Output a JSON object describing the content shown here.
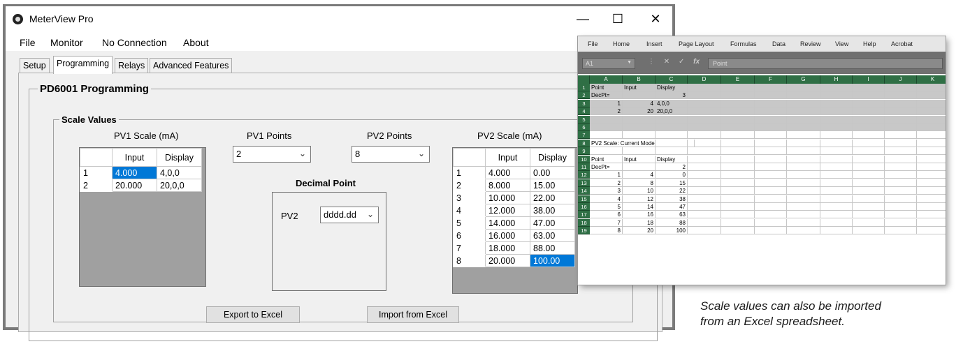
{
  "window": {
    "title": "MeterView Pro",
    "controls": {
      "minimize": "—",
      "maximize": "☐",
      "close": "✕"
    }
  },
  "menu": [
    "File",
    "Monitor",
    "No Connection",
    "About"
  ],
  "tabs": [
    "Setup",
    "Programming",
    "Relays",
    "Advanced Features"
  ],
  "active_tab": "Programming",
  "programming": {
    "group_title": "PD6001 Programming",
    "scale_group_title": "Scale Values",
    "pv1_scale": {
      "label": "PV1 Scale (mA)",
      "headers": [
        "Input",
        "Display"
      ],
      "rows": [
        {
          "n": "1",
          "input": "4.000",
          "display": "4,0,0"
        },
        {
          "n": "2",
          "input": "20.000",
          "display": "20,0,0"
        }
      ]
    },
    "pv1_points": {
      "label": "PV1 Points",
      "value": "2"
    },
    "pv2_points": {
      "label": "PV2 Points",
      "value": "8"
    },
    "decimal_point": {
      "title": "Decimal Point",
      "pv_label": "PV2",
      "value": "dddd.dd"
    },
    "pv2_scale": {
      "label": "PV2 Scale (mA)",
      "headers": [
        "Input",
        "Display"
      ],
      "rows": [
        {
          "n": "1",
          "input": "4.000",
          "display": "0.00"
        },
        {
          "n": "2",
          "input": "8.000",
          "display": "15.00"
        },
        {
          "n": "3",
          "input": "10.000",
          "display": "22.00"
        },
        {
          "n": "4",
          "input": "12.000",
          "display": "38.00"
        },
        {
          "n": "5",
          "input": "14.000",
          "display": "47.00"
        },
        {
          "n": "6",
          "input": "16.000",
          "display": "63.00"
        },
        {
          "n": "7",
          "input": "18.000",
          "display": "88.00"
        },
        {
          "n": "8",
          "input": "20.000",
          "display": "100.00"
        }
      ]
    },
    "export_button": "Export to Excel",
    "import_button": "Import from Excel"
  },
  "excel": {
    "ribbon_tabs": [
      "File",
      "Home",
      "Insert",
      "Page Layout",
      "Formulas",
      "Data",
      "Review",
      "View",
      "Help",
      "Acrobat"
    ],
    "name_box": "A1",
    "formula_value": "Point",
    "fx": "fx",
    "columns": [
      "A",
      "B",
      "C",
      "D",
      "E",
      "F",
      "G",
      "H",
      "I",
      "J",
      "K"
    ],
    "rows": [
      {
        "n": "1",
        "a": "Point",
        "b": "Input",
        "c": "Display"
      },
      {
        "n": "2",
        "a": "DecPt=",
        "b": "",
        "c": "3"
      },
      {
        "n": "3",
        "a": "1",
        "b": "4",
        "c": "4,0,0"
      },
      {
        "n": "4",
        "a": "2",
        "b": "20",
        "c": "20,0,0"
      },
      {
        "n": "5",
        "a": "",
        "b": "",
        "c": ""
      },
      {
        "n": "6",
        "a": "",
        "b": "",
        "c": ""
      },
      {
        "n": "7",
        "a": "",
        "b": "",
        "c": ""
      },
      {
        "n": "8",
        "a": "PV2 Scale: Current Mode",
        "b": "",
        "c": ""
      },
      {
        "n": "9",
        "a": "",
        "b": "",
        "c": ""
      },
      {
        "n": "10",
        "a": "Point",
        "b": "Input",
        "c": "Display"
      },
      {
        "n": "11",
        "a": "DecPt=",
        "b": "",
        "c": "2"
      },
      {
        "n": "12",
        "a": "1",
        "b": "4",
        "c": "0"
      },
      {
        "n": "13",
        "a": "2",
        "b": "8",
        "c": "15"
      },
      {
        "n": "14",
        "a": "3",
        "b": "10",
        "c": "22"
      },
      {
        "n": "15",
        "a": "4",
        "b": "12",
        "c": "38"
      },
      {
        "n": "16",
        "a": "5",
        "b": "14",
        "c": "47"
      },
      {
        "n": "17",
        "a": "6",
        "b": "16",
        "c": "63"
      },
      {
        "n": "18",
        "a": "7",
        "b": "18",
        "c": "88"
      },
      {
        "n": "19",
        "a": "8",
        "b": "20",
        "c": "100"
      }
    ],
    "colors": {
      "header_green": "#2f6f45",
      "selection_gray": "#c8c8c8"
    }
  },
  "caption": {
    "line1": "Scale values can also be imported",
    "line2": "from an Excel spreadsheet."
  }
}
